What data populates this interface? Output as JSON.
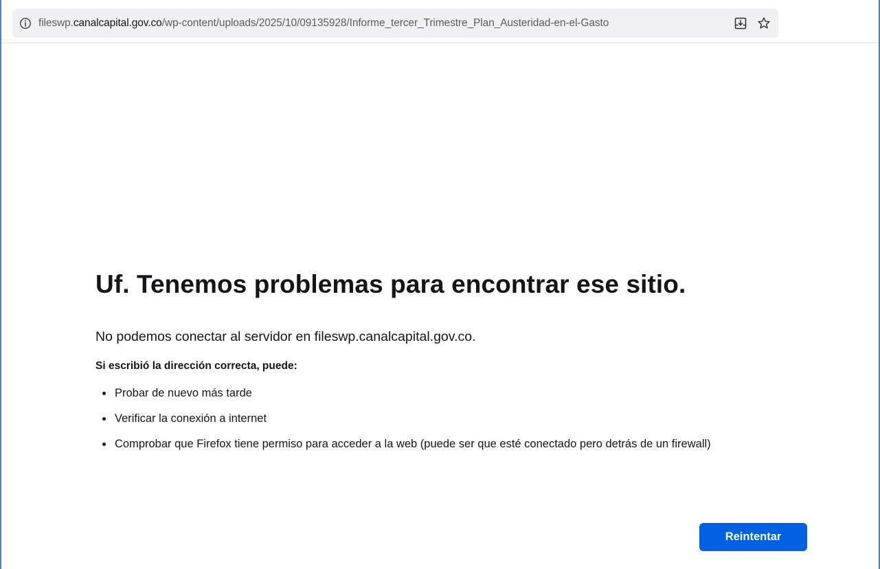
{
  "browser": {
    "url_prefix": "fileswp.",
    "url_host": "canalcapital.gov.co",
    "url_path": "/wp-content/uploads/2025/10/09135928/Informe_tercer_Trimestre_Plan_Austeridad-en-el-Gasto",
    "icons": [
      "info-icon",
      "download-icon",
      "bookmark-star-icon"
    ]
  },
  "error": {
    "title": "Uf. Tenemos problemas para encontrar ese sitio.",
    "description": "No podemos conectar al servidor en fileswp.canalcapital.gov.co.",
    "subheading": "Si escribió la dirección correcta, puede:",
    "suggestions": [
      "Probar de nuevo más tarde",
      "Verificar la conexión a internet",
      "Comprobar que Firefox tiene permiso para acceder a la web (puede ser que esté conectado pero detrás de un firewall)"
    ],
    "retry_label": "Reintentar"
  },
  "colors": {
    "accent": "#0061e0",
    "frame_border": "#4f7bd1",
    "urlbar_bg": "#f0f0f4"
  }
}
